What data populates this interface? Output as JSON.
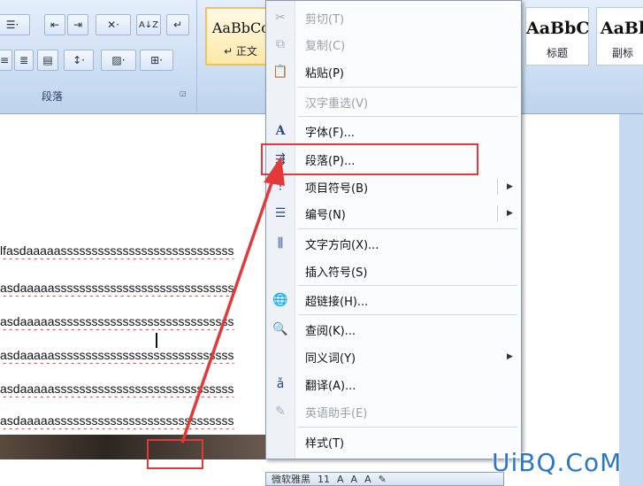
{
  "ribbon": {
    "paragraph_group": {
      "label": "段落",
      "row1": [
        "☰·",
        "⇤",
        "⇥",
        "✕·",
        "A↓Z",
        "↵"
      ],
      "row2": [
        "≡",
        "≣",
        "▤",
        "↕·",
        "▨·",
        "⊞·"
      ]
    },
    "styles": [
      {
        "sample": "AaBbCc",
        "name": "↵ 正文",
        "selected": true
      },
      {
        "sample": "AaBbC",
        "name": "标题",
        "selected": false
      },
      {
        "sample": "AaBl",
        "name": "副标",
        "selected": false
      }
    ]
  },
  "document": {
    "lines": [
      "lfasdaaaaassssssssssssssssssssssssssss",
      "asdaaaaasssssssssssssssssssssssssssss",
      "asdaaaaasssssssssssssssssssssssssssss",
      "asdaaaaasssssssssssssssssssssssssssss",
      "asdaaaaasssssssssssssssssssssssssssss",
      "asdaaaaasssssssssssssssssssssssssssss"
    ]
  },
  "context_menu": {
    "items": [
      {
        "label": "剪切(T)",
        "icon": "scissors-icon",
        "glyph": "✂",
        "disabled": true
      },
      {
        "label": "复制(C)",
        "icon": "copy-icon",
        "glyph": "⧉",
        "disabled": true
      },
      {
        "label": "粘贴(P)",
        "icon": "paste-icon",
        "glyph": "📋",
        "disabled": false
      },
      {
        "label": "汉字重选(V)",
        "icon": "",
        "glyph": "",
        "disabled": true
      },
      {
        "label": "字体(F)...",
        "icon": "font-icon",
        "glyph": "A",
        "disabled": false
      },
      {
        "label": "段落(P)...",
        "icon": "paragraph-icon",
        "glyph": "⇶",
        "disabled": false,
        "highlighted": true
      },
      {
        "label": "项目符号(B)",
        "icon": "bullets-icon",
        "glyph": "⁝",
        "disabled": false,
        "submenu": true
      },
      {
        "label": "编号(N)",
        "icon": "numbering-icon",
        "glyph": "☰",
        "disabled": false,
        "submenu": true
      },
      {
        "label": "文字方向(X)...",
        "icon": "text-direction-icon",
        "glyph": "⫼",
        "disabled": false
      },
      {
        "label": "插入符号(S)",
        "icon": "",
        "glyph": "",
        "disabled": false
      },
      {
        "label": "超链接(H)...",
        "icon": "hyperlink-icon",
        "glyph": "🌐",
        "disabled": false
      },
      {
        "label": "查阅(K)...",
        "icon": "lookup-icon",
        "glyph": "🔍",
        "disabled": false
      },
      {
        "label": "同义词(Y)",
        "icon": "",
        "glyph": "",
        "disabled": false,
        "submenu": true
      },
      {
        "label": "翻译(A)...",
        "icon": "translate-icon",
        "glyph": "ǎ",
        "disabled": false
      },
      {
        "label": "英语助手(E)",
        "icon": "english-assistant-icon",
        "glyph": "✎",
        "disabled": true
      },
      {
        "label": "样式(T)",
        "icon": "",
        "glyph": "",
        "disabled": false
      }
    ]
  },
  "mini_toolbar": {
    "font": "微软雅黑",
    "size": "11",
    "extras": [
      "A",
      "A",
      "A",
      "✎"
    ]
  },
  "watermark": "UiBQ.CoM",
  "colors": {
    "highlight_box": "#e23a3a",
    "arrow": "#e23a3a",
    "watermark": "#2b78c5"
  }
}
